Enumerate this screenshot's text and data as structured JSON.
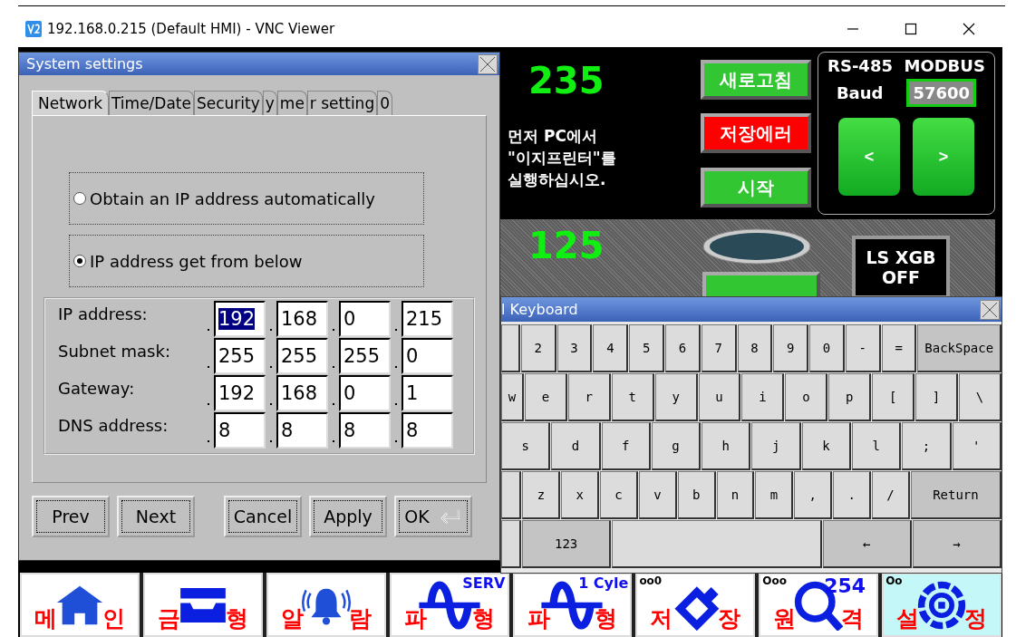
{
  "window": {
    "title": "192.168.0.215 (Default HMI) - VNC Viewer"
  },
  "hmi": {
    "top_value": "235",
    "message": [
      "먼저 PC에서",
      "\"이지프린터\"를",
      "실행하십시오."
    ],
    "buttons": [
      {
        "label": "새로고침",
        "kind": "normal"
      },
      {
        "label": "저장에러",
        "kind": "alarm"
      },
      {
        "label": "시작",
        "kind": "normal"
      }
    ],
    "serial": {
      "title": "RS-485  MODBUS",
      "baud_label": "Baud",
      "baud_value": "57600",
      "buttons": [
        "<",
        ">"
      ]
    },
    "bottom_value": "125",
    "lamp": {
      "on": false
    },
    "plc": [
      "LS XGB",
      "OFF"
    ]
  },
  "dialog": {
    "title": "System settings",
    "tabs": [
      {
        "label": "Network",
        "selected": true
      },
      {
        "label": "Time/Date",
        "selected": false
      },
      {
        "label": "Security",
        "selected": false
      },
      {
        "label": "y",
        "selected": false
      },
      {
        "label": "me",
        "selected": false
      },
      {
        "label": "r setting",
        "selected": false
      },
      {
        "label": "0",
        "selected": false
      }
    ],
    "options": [
      {
        "label": "Obtain an IP address automatically",
        "selected": false
      },
      {
        "label": "IP address get from below",
        "selected": true
      }
    ],
    "fields": [
      {
        "label": "IP address:",
        "octets": [
          {
            "value": "192",
            "selected": true
          },
          {
            "value": "168",
            "selected": false
          },
          {
            "value": "0",
            "selected": false
          },
          {
            "value": "215",
            "selected": false
          }
        ]
      },
      {
        "label": "Subnet mask:",
        "octets": [
          {
            "value": "255",
            "selected": false
          },
          {
            "value": "255",
            "selected": false
          },
          {
            "value": "255",
            "selected": false
          },
          {
            "value": "0",
            "selected": false
          }
        ]
      },
      {
        "label": "Gateway:",
        "octets": [
          {
            "value": "192",
            "selected": false
          },
          {
            "value": "168",
            "selected": false
          },
          {
            "value": "0",
            "selected": false
          },
          {
            "value": "1",
            "selected": false
          }
        ]
      },
      {
        "label": "DNS address:",
        "octets": [
          {
            "value": "8",
            "selected": false
          },
          {
            "value": "8",
            "selected": false
          },
          {
            "value": "8",
            "selected": false
          },
          {
            "value": "8",
            "selected": false
          }
        ]
      }
    ],
    "buttons": [
      {
        "label": "Prev",
        "kind": "plain"
      },
      {
        "label": "Next",
        "kind": "plain"
      },
      {
        "label": "Cancel",
        "kind": "plain"
      },
      {
        "label": "Apply",
        "kind": "plain"
      },
      {
        "label": "OK",
        "kind": "enter"
      }
    ]
  },
  "keyboard": {
    "title": "l Keyboard",
    "rows": [
      {
        "keys": [
          {
            "kind": "partial"
          },
          {
            "label": "2",
            "kind": "key"
          },
          {
            "label": "3",
            "kind": "key"
          },
          {
            "label": "4",
            "kind": "key"
          },
          {
            "label": "5",
            "kind": "key"
          },
          {
            "label": "6",
            "kind": "key"
          },
          {
            "label": "7",
            "kind": "key"
          },
          {
            "label": "8",
            "kind": "key"
          },
          {
            "label": "9",
            "kind": "key"
          },
          {
            "label": "0",
            "kind": "key"
          },
          {
            "label": "-",
            "kind": "key"
          },
          {
            "label": "=",
            "kind": "key"
          },
          {
            "label": "BackSpace",
            "kind": "fn"
          }
        ]
      },
      {
        "keys": [
          {
            "label": "w",
            "kind": "partial"
          },
          {
            "label": "e",
            "kind": "key"
          },
          {
            "label": "r",
            "kind": "key"
          },
          {
            "label": "t",
            "kind": "key"
          },
          {
            "label": "y",
            "kind": "key"
          },
          {
            "label": "u",
            "kind": "key"
          },
          {
            "label": "i",
            "kind": "key"
          },
          {
            "label": "o",
            "kind": "key"
          },
          {
            "label": "p",
            "kind": "key"
          },
          {
            "label": "[",
            "kind": "key"
          },
          {
            "label": "]",
            "kind": "key"
          },
          {
            "label": "\\",
            "kind": "key"
          }
        ]
      },
      {
        "keys": [
          {
            "label": "s",
            "kind": "key"
          },
          {
            "label": "d",
            "kind": "key"
          },
          {
            "label": "f",
            "kind": "key"
          },
          {
            "label": "g",
            "kind": "key"
          },
          {
            "label": "h",
            "kind": "key"
          },
          {
            "label": "j",
            "kind": "key"
          },
          {
            "label": "k",
            "kind": "key"
          },
          {
            "label": "l",
            "kind": "key"
          },
          {
            "label": ";",
            "kind": "key"
          },
          {
            "label": "'",
            "kind": "key"
          }
        ]
      },
      {
        "keys": [
          {
            "kind": "partial"
          },
          {
            "label": "z",
            "kind": "key"
          },
          {
            "label": "x",
            "kind": "key"
          },
          {
            "label": "c",
            "kind": "key"
          },
          {
            "label": "v",
            "kind": "key"
          },
          {
            "label": "b",
            "kind": "key"
          },
          {
            "label": "n",
            "kind": "key"
          },
          {
            "label": "m",
            "kind": "key"
          },
          {
            "label": ",",
            "kind": "key"
          },
          {
            "label": ".",
            "kind": "key"
          },
          {
            "label": "/",
            "kind": "key"
          },
          {
            "label": "Return",
            "kind": "fn"
          }
        ]
      },
      {
        "keys": [
          {
            "kind": "partial"
          },
          {
            "label": "123",
            "kind": "fn"
          },
          {
            "kind": "space"
          },
          {
            "label": "←",
            "kind": "fn"
          },
          {
            "label": "→",
            "kind": "fn"
          }
        ]
      }
    ]
  },
  "nav": [
    {
      "left": "메",
      "right": "인",
      "kind": "home",
      "selected": false
    },
    {
      "left": "금",
      "right": "형",
      "kind": "mold",
      "selected": false
    },
    {
      "left": "알",
      "right": "람",
      "kind": "bell",
      "selected": false
    },
    {
      "left": "파",
      "right": "형",
      "kind": "wave",
      "badge": "SERV",
      "selected": false
    },
    {
      "left": "파",
      "right": "형",
      "kind": "wave",
      "badge": "1 Cyle",
      "selected": false
    },
    {
      "left": "저",
      "right": "장",
      "kind": "tag",
      "corner": "oo0",
      "selected": false
    },
    {
      "left": "원",
      "right": "격",
      "kind": "search",
      "corner": "Ooo",
      "badge": "254",
      "selected": false
    },
    {
      "left": "설",
      "right": "정",
      "kind": "gear",
      "corner": "Oo",
      "selected": true
    }
  ]
}
